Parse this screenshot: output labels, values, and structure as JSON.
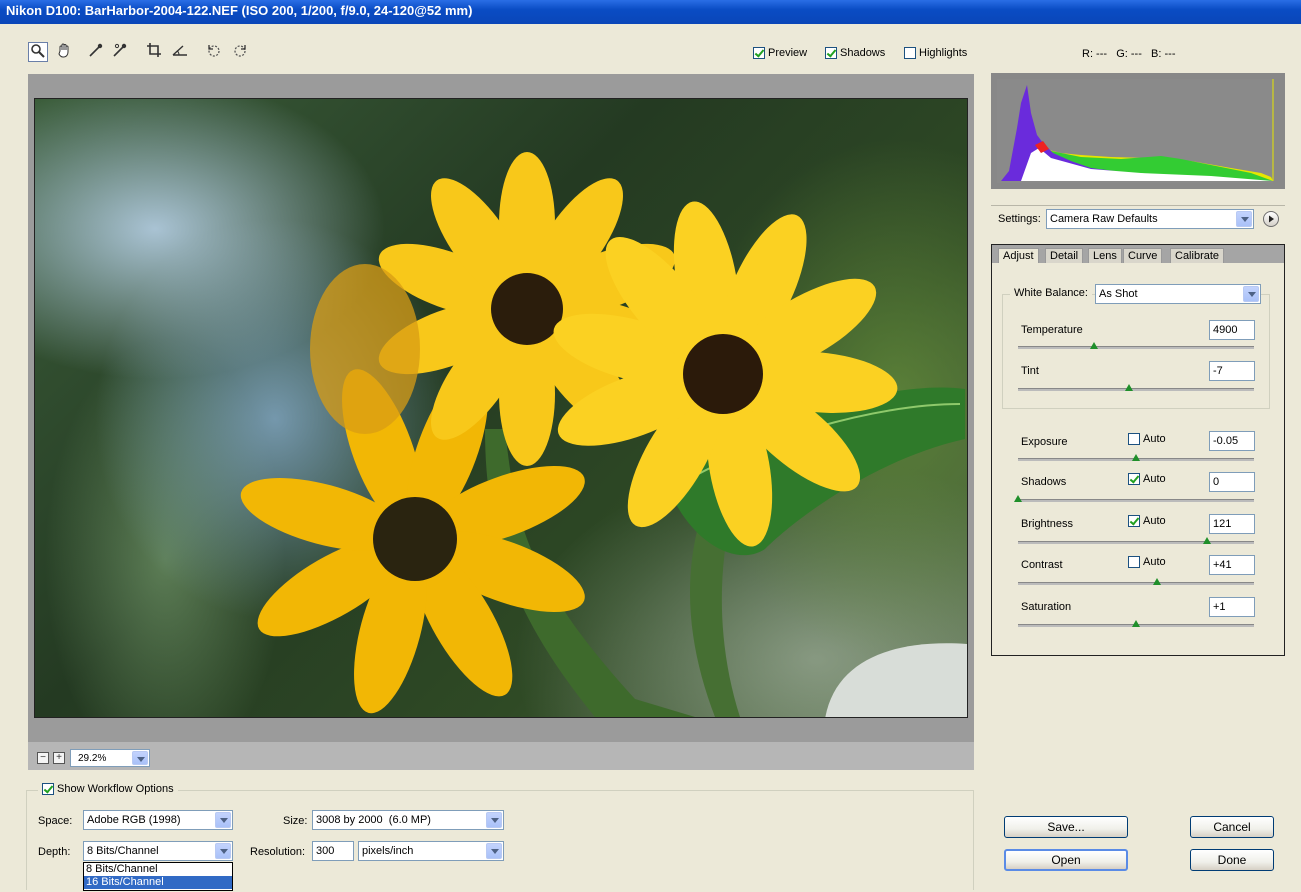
{
  "window": {
    "title": "Nikon D100:  BarHarbor-2004-122.NEF  (ISO 200, 1/200, f/9.0, 24-120@52 mm)"
  },
  "toolbar": {
    "tools": [
      "zoom-tool-icon",
      "hand-tool-icon",
      "white-balance-tool-icon",
      "color-sampler-tool-icon",
      "crop-tool-icon",
      "straighten-tool-icon",
      "rotate-left-icon",
      "rotate-right-icon"
    ]
  },
  "options": {
    "preview": {
      "label": "Preview",
      "checked": true
    },
    "shadows": {
      "label": "Shadows",
      "checked": true
    },
    "highlights": {
      "label": "Highlights",
      "checked": false
    }
  },
  "rgb_readout": "R: ---   G: ---   B: ---",
  "zoom": {
    "value": "29.2%"
  },
  "settings": {
    "label": "Settings:",
    "value": "Camera Raw Defaults"
  },
  "tabs": [
    "Adjust",
    "Detail",
    "Lens",
    "Curve",
    "Calibrate"
  ],
  "white_balance": {
    "label": "White Balance:",
    "value": "As Shot"
  },
  "temperature": {
    "label": "Temperature",
    "value": "4900",
    "level": 0.32
  },
  "tint": {
    "label": "Tint",
    "value": "-7",
    "level": 0.47
  },
  "exposure": {
    "label": "Exposure",
    "auto_label": "Auto",
    "auto": false,
    "value": "-0.05",
    "level": 0.5
  },
  "shadows_adj": {
    "label": "Shadows",
    "auto_label": "Auto",
    "auto": true,
    "value": "0",
    "level": 0.0
  },
  "brightness": {
    "label": "Brightness",
    "auto_label": "Auto",
    "auto": true,
    "value": "121",
    "level": 0.8
  },
  "contrast": {
    "label": "Contrast",
    "auto_label": "Auto",
    "auto": false,
    "value": "+41",
    "level": 0.59
  },
  "saturation": {
    "label": "Saturation",
    "value": "+1",
    "level": 0.5
  },
  "workflow": {
    "show_label": "Show Workflow Options",
    "show_checked": true,
    "space_label": "Space:",
    "space_value": "Adobe RGB (1998)",
    "size_label": "Size:",
    "size_value": "3008 by 2000  (6.0 MP)",
    "depth_label": "Depth:",
    "depth_value": "8 Bits/Channel",
    "depth_options": [
      "8 Bits/Channel",
      "16 Bits/Channel"
    ],
    "resolution_label": "Resolution:",
    "resolution_value": "300",
    "resolution_unit": "pixels/inch"
  },
  "buttons": {
    "save": "Save...",
    "cancel": "Cancel",
    "open": "Open",
    "done": "Done"
  },
  "colors": {
    "title_bar": "#0a4cc4",
    "dialog_bg": "#ece9d8",
    "check_green": "#21a121",
    "slider_thumb": "#1f8f2a"
  }
}
